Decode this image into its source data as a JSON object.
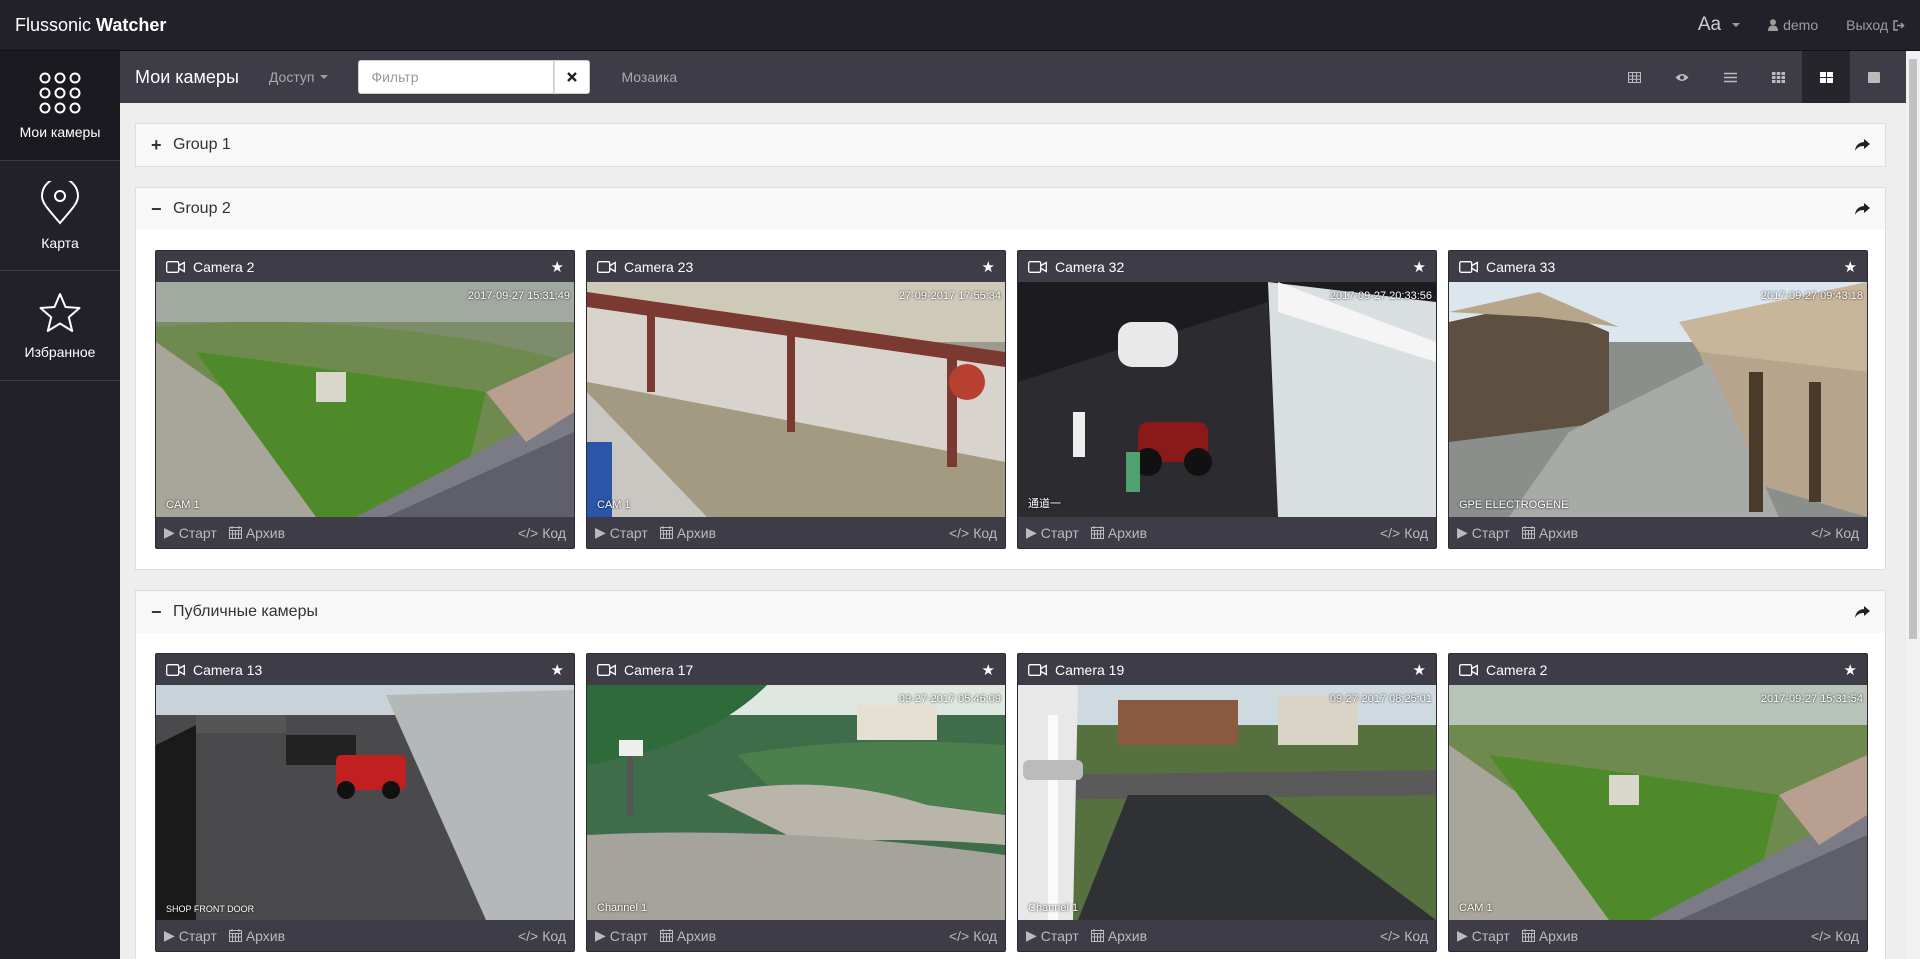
{
  "brand": {
    "light": "Flussonic ",
    "bold": "Watcher"
  },
  "topbar": {
    "font_label": "Aa",
    "user": "demo",
    "logout": "Выход"
  },
  "sidebar": {
    "items": [
      {
        "label": "Мои камеры",
        "icon": "grid-dots-icon"
      },
      {
        "label": "Карта",
        "icon": "map-pin-icon"
      },
      {
        "label": "Избранное",
        "icon": "star-icon"
      }
    ]
  },
  "toolbar": {
    "title": "Мои камеры",
    "access_label": "Доступ",
    "filter_placeholder": "Фильтр",
    "mosaic_label": "Мозаика",
    "views": [
      "table-icon",
      "eye-icon",
      "list-icon",
      "grid-small-icon",
      "grid-large-icon",
      "single-icon"
    ],
    "active_view": 4
  },
  "camera_actions": {
    "start": "Старт",
    "archive": "Архив",
    "code": "Код"
  },
  "groups": [
    {
      "name": "Group 1",
      "expanded": false,
      "sign": "+"
    },
    {
      "name": "Group 2",
      "expanded": true,
      "sign": "−",
      "cameras": [
        {
          "name": "Camera 2",
          "timestamp": "2017-09-27 15:31:49",
          "label": "CAM 1"
        },
        {
          "name": "Camera 23",
          "timestamp": "27-09-2017 17:55:34",
          "label": "CAM 1"
        },
        {
          "name": "Camera 32",
          "timestamp": "2017-09-27 20:33:56",
          "label": "通道一"
        },
        {
          "name": "Camera 33",
          "timestamp": "2017-09-27 09:43:18",
          "label": "GPE ELECTROGENE"
        }
      ]
    },
    {
      "name": "Публичные камеры",
      "expanded": true,
      "sign": "−",
      "cameras": [
        {
          "name": "Camera 13",
          "timestamp": "",
          "label": "SHOP FRONT DOOR"
        },
        {
          "name": "Camera 17",
          "timestamp": "09-27-2017 05:46:09",
          "label": "Channel 1"
        },
        {
          "name": "Camera 19",
          "timestamp": "09-27-2017 08:25:01",
          "label": "Channel 1"
        },
        {
          "name": "Camera 2",
          "timestamp": "2017-09-27 15:31:54",
          "label": "CAM 1"
        }
      ]
    }
  ]
}
